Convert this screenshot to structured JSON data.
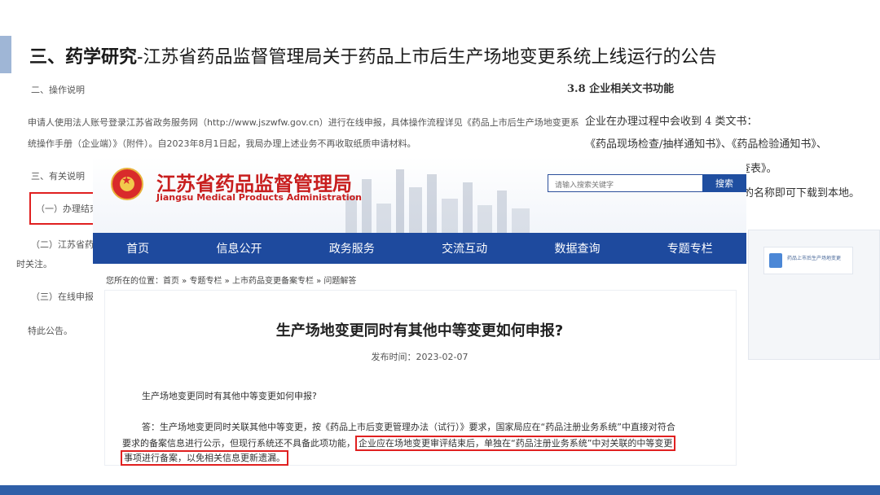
{
  "slide": {
    "title_strong": "三、药学研究",
    "title_rest": "-江苏省药品监督管理局关于药品上市后生产场地变更系统上线运行的公告"
  },
  "doc_left": {
    "p1": "二、操作说明",
    "p2": "申请人使用法人账号登录江苏省政务服务网（http://www.jszwfw.gov.cn）进行在线申报，具体操作流程详见《药品上市后生产场地变更系",
    "p3": "统操作手册（企业端）》（附件）。自2023年8月1日起，我局办理上述业务不再收取纸质申请材料。",
    "p4": "三、有关说明",
    "p5": "（一）办理结束后",
    "p6": "（二）江苏省药品",
    "p7": "时关注。",
    "p8": "（三）在线申报",
    "p9": "特此公告。"
  },
  "doc_right": {
    "heading": "3.8 企业相关文书功能",
    "l1": "企业在办理过程中会收到 4 类文书：",
    "l2": "《药品现场检查/抽样通知书》、《药品检验通知书》、",
    "l3": "查表》。",
    "l4": "的名称即可下载到本地。"
  },
  "right_card": {
    "tile_text": "药品上市后生产场地变更"
  },
  "site": {
    "name_cn": "江苏省药品监督管理局",
    "name_en": "Jiangsu Medical Products Administration",
    "search_placeholder": "请输入搜索关键字",
    "search_button": "搜索",
    "nav": [
      "首页",
      "信息公开",
      "政务服务",
      "交流互动",
      "数据查询",
      "专题专栏"
    ],
    "breadcrumb": "您所在的位置：首页 » 专题专栏 » 上市药品变更备案专栏 » 问题解答",
    "article_title": "生产场地变更同时有其他中等变更如何申报?",
    "article_date": "发布时间：2023-02-07",
    "question": "生产场地变更同时有其他中等变更如何申报?",
    "answer_line1": "答：生产场地变更同时关联其他中等变更，按《药品上市后变更管理办法（试行）》要求，国家局应在“药品注册业务系统”中直接对符合",
    "answer_line2_plain": "要求的备案信息进行公示，但现行系统还不具备此项功能，",
    "answer_line2_highlight": "企业应在场地变更审评结束后，单独在“药品注册业务系统”中对关联的中等变更",
    "answer_line3_highlight": "事项进行备案，以免相关信息更新遗漏。"
  },
  "colors": {
    "nav_blue": "#1e4a9e",
    "brand_red": "#c81e1e",
    "highlight_red": "#e02020"
  }
}
